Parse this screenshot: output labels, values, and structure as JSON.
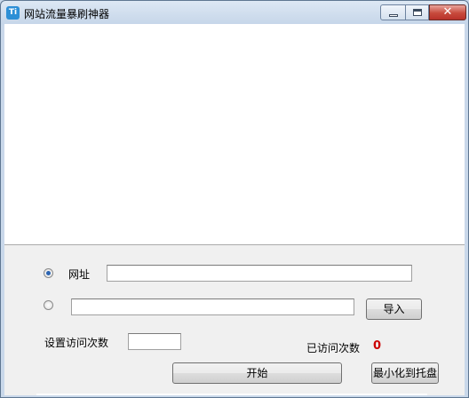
{
  "window": {
    "title": "网站流量暴刷神器",
    "icon_label": "Ti",
    "close_glyph": "✕"
  },
  "log": {
    "content": ""
  },
  "form": {
    "url_radio_selected": true,
    "url_label": "网址",
    "url_value": "",
    "file_radio_selected": false,
    "file_value": "",
    "import_button": "导入",
    "visits_label": "设置访问次数",
    "visits_value": "",
    "visited_label": "已访问次数",
    "visited_count": "0",
    "start_button": "开始",
    "tray_button": "最小化到托盘"
  },
  "colors": {
    "count": "#cc0000",
    "radio_dot": "#2c64b2",
    "close_button": "#c74a3c"
  }
}
